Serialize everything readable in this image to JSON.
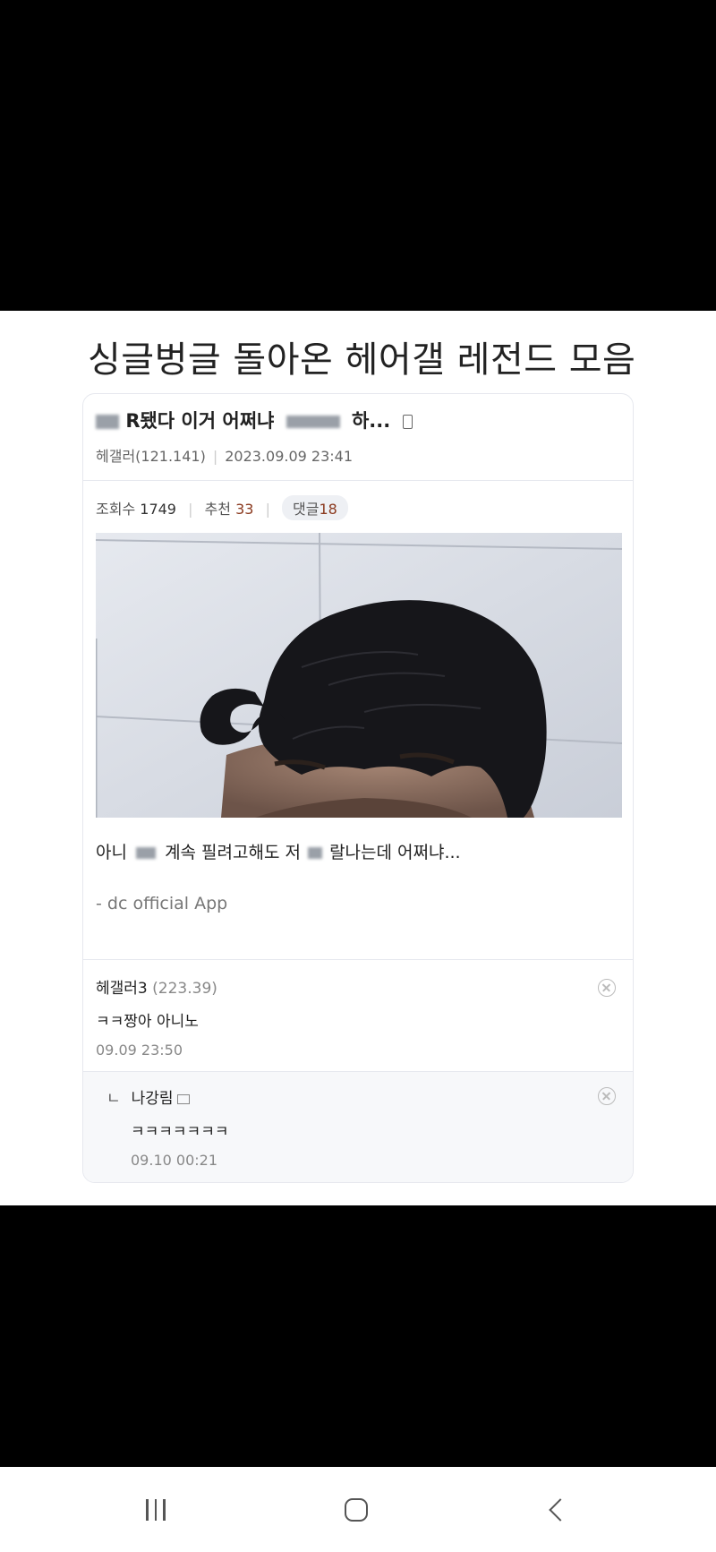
{
  "page_title": "싱글벙글 돌아온 헤어갤 레전드 모음",
  "post": {
    "title_part1": "R됐다 이거 어쩌냐",
    "title_part2": "하...",
    "author": "헤갤러(121.141)",
    "datetime": "2023.09.09 23:41",
    "views_label": "조회수",
    "views": "1749",
    "recommend_label": "추천",
    "recommend": "33",
    "comments_label": "댓글",
    "comments": "18",
    "body_part1": "아니",
    "body_part2": "계속 필려고해도 저",
    "body_part3": "랄나는데 어쩌냐...",
    "app_signature": "- dc official App"
  },
  "comments": [
    {
      "author": "헤갤러3",
      "ip": "(223.39)",
      "text": "ㅋㅋ짱아 아니노",
      "time": "09.09 23:50"
    }
  ],
  "reply": {
    "marker": "ㄴ",
    "author": "나강림",
    "text": "ㅋㅋㅋㅋㅋㅋㅋ",
    "time": "09.10 00:21"
  }
}
